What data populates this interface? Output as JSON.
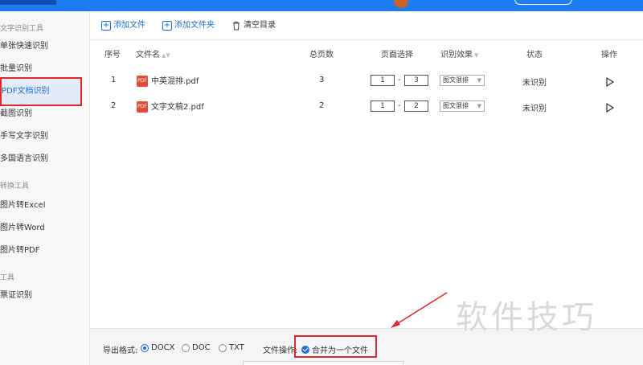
{
  "sidebar": {
    "groups": [
      "文字识别工具",
      "转换工具",
      "工具"
    ],
    "items": [
      {
        "label": "单张快速识别"
      },
      {
        "label": "批量识别"
      },
      {
        "label": "PDF文档识别"
      },
      {
        "label": "截图识别"
      },
      {
        "label": "手写文字识别"
      },
      {
        "label": "多国语言识别"
      },
      {
        "label": "图片转Excel"
      },
      {
        "label": "图片转Word"
      },
      {
        "label": "图片转PDF"
      },
      {
        "label": "票证识别"
      }
    ]
  },
  "toolbar": {
    "add_file": "添加文件",
    "add_folder": "添加文件夹",
    "clear": "清空目录"
  },
  "table": {
    "headers": [
      "序号",
      "文件名",
      "总页数",
      "页面选择",
      "识别效果",
      "状态",
      "操作"
    ],
    "rows": [
      {
        "index": "1",
        "name": "中英混排.pdf",
        "pages": "3",
        "from": "1",
        "to": "3",
        "effect": "图文混排",
        "status": "未识别"
      },
      {
        "index": "2",
        "name": "文字文稿2.pdf",
        "pages": "2",
        "from": "1",
        "to": "2",
        "effect": "图文混排",
        "status": "未识别"
      }
    ]
  },
  "bottom": {
    "format_label": "导出格式:",
    "formats": [
      "DOCX",
      "DOC",
      "TXT"
    ],
    "selected_format": "DOCX",
    "file_op_label": "文件操作:",
    "merge_label": "合并为一个文件"
  },
  "icons": {
    "add_file": "add-file-icon",
    "add_folder": "add-folder-icon",
    "clear": "trash-icon",
    "pdf": "pdf-file-icon",
    "play": "play-icon"
  },
  "colors": {
    "accent": "#1e6de0",
    "highlight_red": "#e0272b",
    "pdf_red": "#e34a3b"
  },
  "watermark": "软件技巧"
}
